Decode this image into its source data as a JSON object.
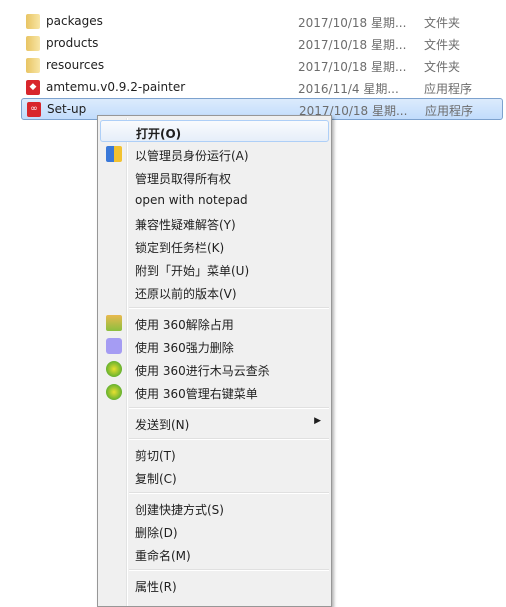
{
  "files": [
    {
      "name": "packages",
      "date": "2017/10/18 星期...",
      "type": "文件夹",
      "icon": "folder-icon"
    },
    {
      "name": "products",
      "date": "2017/10/18 星期...",
      "type": "文件夹",
      "icon": "folder-icon"
    },
    {
      "name": "resources",
      "date": "2017/10/18 星期...",
      "type": "文件夹",
      "icon": "folder-icon"
    },
    {
      "name": "amtemu.v0.9.2-painter",
      "date": "2016/11/4 星期...",
      "type": "应用程序",
      "icon": "amtemu-app-icon"
    },
    {
      "name": "Set-up",
      "date": "2017/10/18 星期...",
      "type": "应用程序",
      "icon": "adobe-cc-app-icon",
      "selected": true
    }
  ],
  "menu": {
    "open": "打开(O)",
    "run_as_admin": "以管理员身份运行(A)",
    "take_ownership": "管理员取得所有权",
    "open_notepad": "open with notepad",
    "compat": "兼容性疑难解答(Y)",
    "pin_taskbar": "锁定到任务栏(K)",
    "pin_start": "附到「开始」菜单(U)",
    "restore": "还原以前的版本(V)",
    "unlock360": "使用 360解除占用",
    "delete360": "使用 360强力删除",
    "scan360": "使用 360进行木马云查杀",
    "manage360": "使用 360管理右键菜单",
    "send_to": "发送到(N)",
    "cut": "剪切(T)",
    "copy": "复制(C)",
    "shortcut": "创建快捷方式(S)",
    "delete": "删除(D)",
    "rename": "重命名(M)",
    "properties": "属性(R)"
  }
}
